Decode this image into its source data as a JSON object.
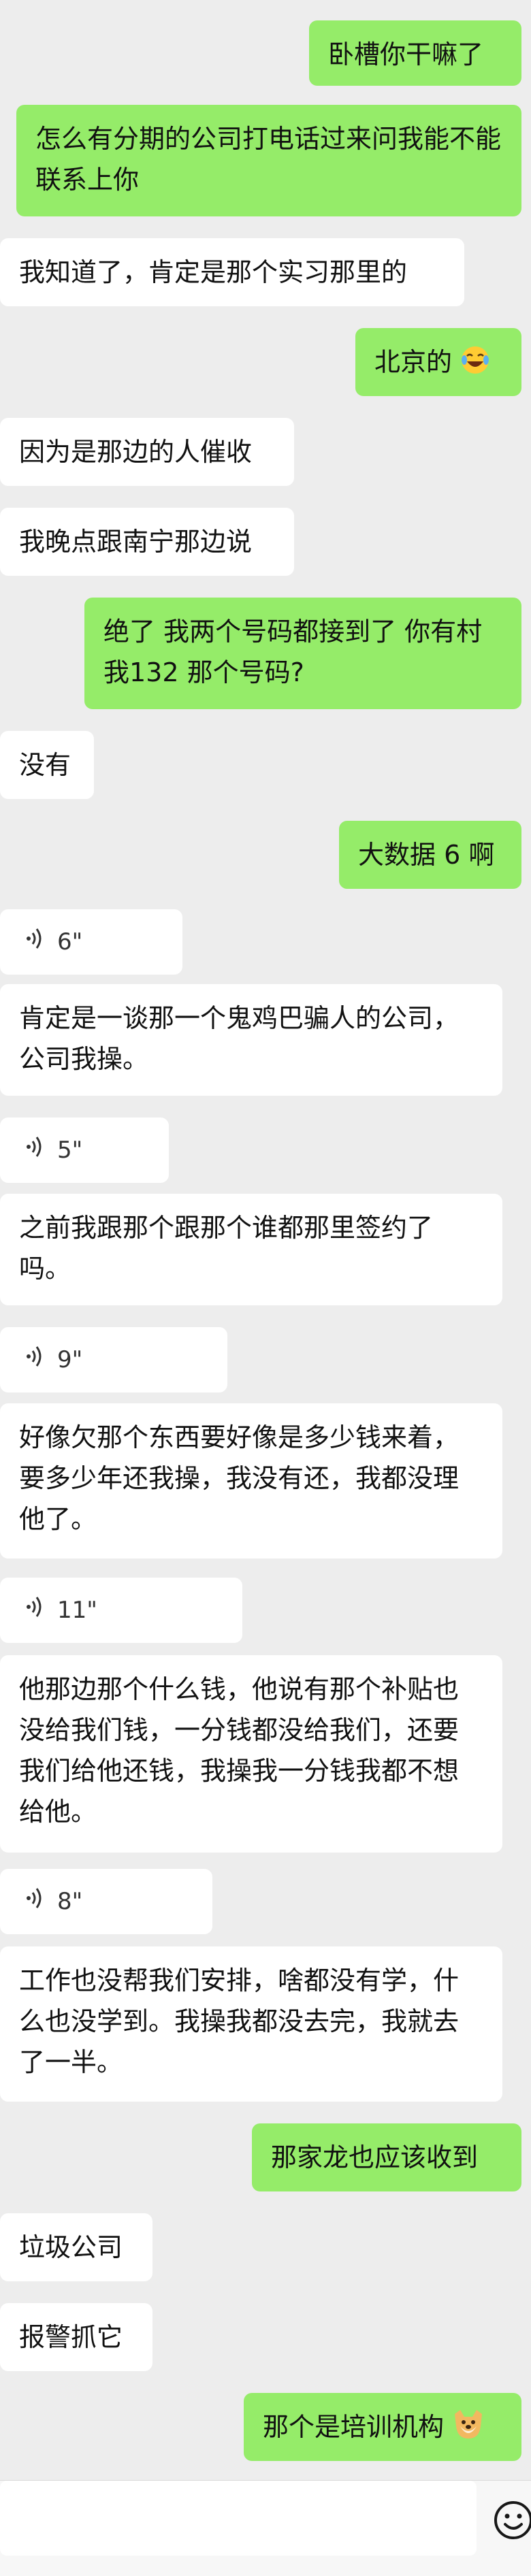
{
  "messages": [
    {
      "side": "me",
      "text": "卧槽你干嘛了"
    },
    {
      "side": "me",
      "text": "怎么有分期的公司打电话过来问我能不能联系上你"
    },
    {
      "side": "them",
      "text": "我知道了，肯定是那个实习那里的"
    },
    {
      "side": "me",
      "text": "北京的"
    },
    {
      "side": "them",
      "text": "因为是那边的人催收"
    },
    {
      "side": "them",
      "text": "我晚点跟南宁那边说"
    },
    {
      "side": "me",
      "text": "绝了 我两个号码都接到了 你有村我132 那个号码?"
    },
    {
      "side": "them",
      "text": "没有"
    },
    {
      "side": "me",
      "text": "大数据 6 啊"
    },
    {
      "side": "them",
      "type": "voice",
      "duration": "6\""
    },
    {
      "side": "them",
      "text": "肯定是一谈那一个鬼鸡巴骗人的公司，公司我操。"
    },
    {
      "side": "them",
      "type": "voice",
      "duration": "5\""
    },
    {
      "side": "them",
      "text": "之前我跟那个跟那个谁都那里签约了吗。"
    },
    {
      "side": "them",
      "type": "voice",
      "duration": "9\""
    },
    {
      "side": "them",
      "text": "好像欠那个东西要好像是多少钱来着，要多少年还我操，我没有还，我都没理他了。"
    },
    {
      "side": "them",
      "type": "voice",
      "duration": "11\""
    },
    {
      "side": "them",
      "text": "他那边那个什么钱，他说有那个补贴也没给我们钱，一分钱都没给我们，还要我们给他还钱，我操我一分钱我都不想给他。"
    },
    {
      "side": "them",
      "type": "voice",
      "duration": "8\""
    },
    {
      "side": "them",
      "text": "工作也没帮我们安排，啥都没有学，什么也没学到。我操我都没去完，我就去了一半。"
    },
    {
      "side": "me",
      "text": "那家龙也应该收到"
    },
    {
      "side": "them",
      "text": "垃圾公司"
    },
    {
      "side": "them",
      "text": "报警抓它"
    },
    {
      "side": "me",
      "text": "那个是培训机构"
    }
  ],
  "colors": {
    "me_bubble": "#95ec69",
    "them_bubble": "#ffffff",
    "background": "#ededed"
  },
  "icons": {
    "laugh_emoji": "tears-of-joy-emoji",
    "doge_emoji": "doge-emoji",
    "voice": "voice-wave-icon",
    "emoji_button": "smiley-face-icon"
  }
}
